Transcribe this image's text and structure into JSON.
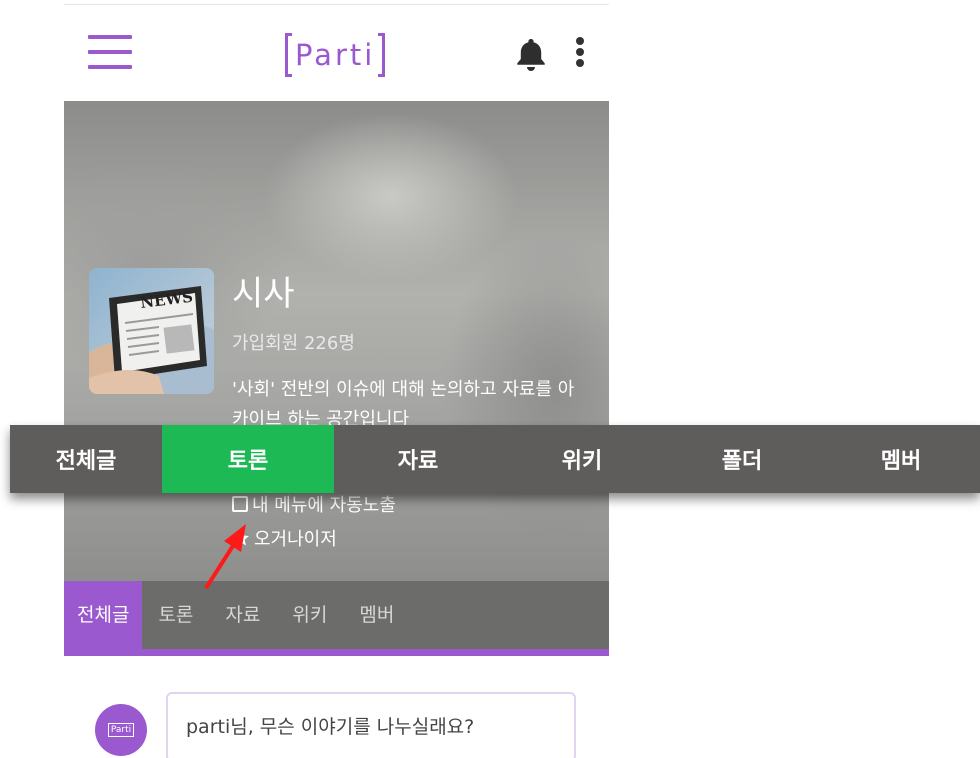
{
  "header": {
    "logo_text": "Parti",
    "icons": {
      "menu": "hamburger-icon",
      "notifications": "bell-icon",
      "more": "kebab-icon"
    },
    "accent_color": "#9b59d0"
  },
  "hero": {
    "title": "시사",
    "members": "가입회원  226명",
    "description": "'사회' 전반의 이슈에 대해 논의하고 자료를 아카이브 하는 공간입니다",
    "auto_menu_label": "내 메뉴에 자동노출",
    "organizer_label": "오거나이저"
  },
  "sub_tabs": [
    {
      "label": "전체글",
      "active": true
    },
    {
      "label": "토론",
      "active": false
    },
    {
      "label": "자료",
      "active": false
    },
    {
      "label": "위키",
      "active": false
    },
    {
      "label": "멤버",
      "active": false
    }
  ],
  "composer": {
    "avatar_text": "Parti",
    "placeholder": "parti님, 무슨 이야기를 나누실래요?"
  },
  "zoom_tabs": [
    {
      "label": "전체글",
      "active": false
    },
    {
      "label": "토론",
      "active": true
    },
    {
      "label": "자료",
      "active": false
    },
    {
      "label": "위키",
      "active": false
    },
    {
      "label": "폴더",
      "active": false
    },
    {
      "label": "멤버",
      "active": false
    }
  ],
  "colors": {
    "active_tab": "#1db954",
    "annotation_arrow": "#ff1a1a"
  }
}
